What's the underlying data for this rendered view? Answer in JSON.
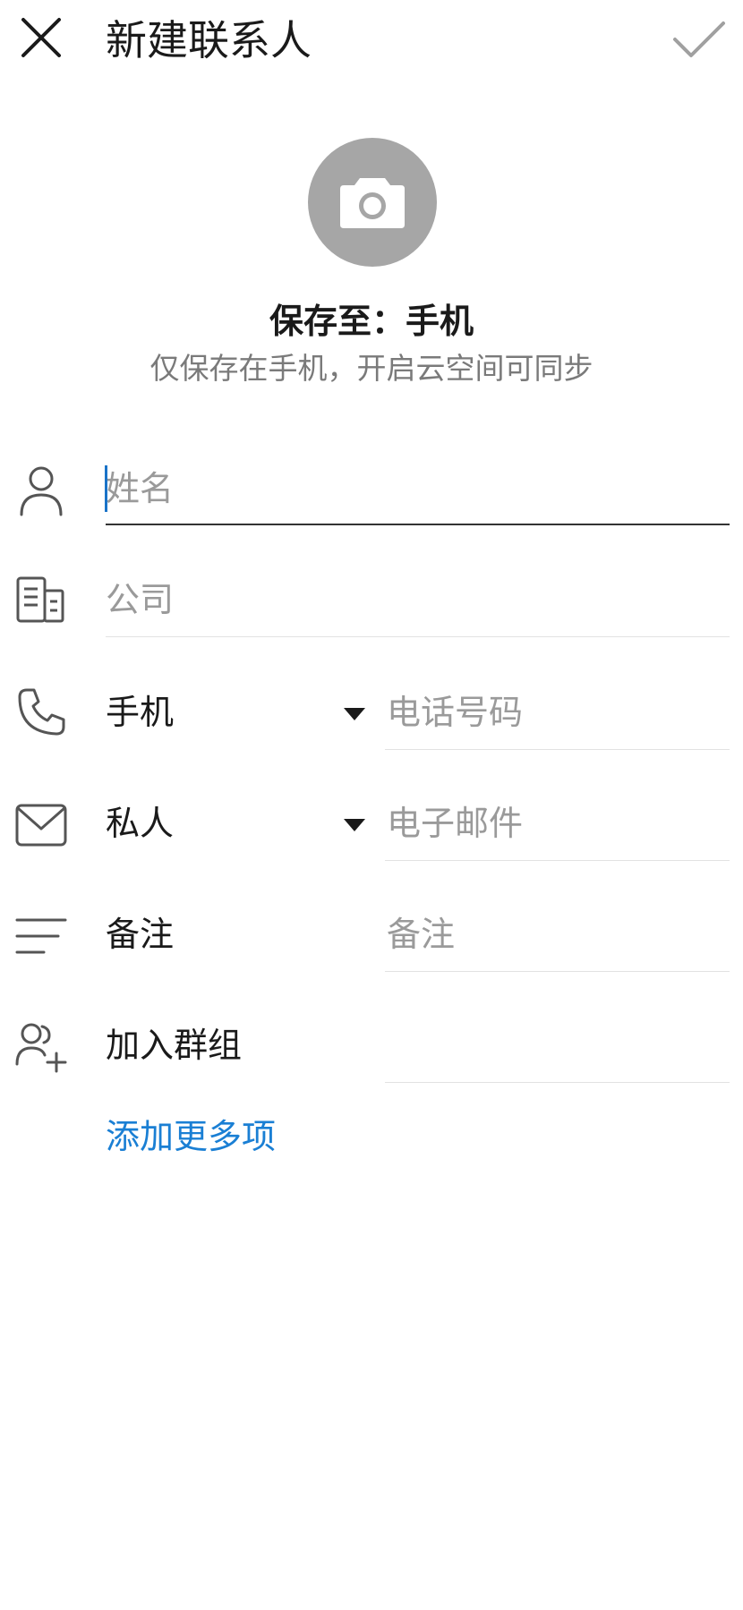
{
  "header": {
    "title": "新建联系人",
    "close_icon": "close-icon",
    "confirm_icon": "check-icon"
  },
  "avatar": {
    "icon": "camera-icon",
    "save_to": "保存至：手机",
    "save_hint": "仅保存在手机，开启云空间可同步"
  },
  "fields": {
    "name": {
      "icon": "person-icon",
      "placeholder": "姓名",
      "value": ""
    },
    "company": {
      "icon": "company-icon",
      "placeholder": "公司",
      "value": ""
    },
    "phone": {
      "icon": "phone-icon",
      "type_label": "手机",
      "placeholder": "电话号码",
      "value": ""
    },
    "email": {
      "icon": "mail-icon",
      "type_label": "私人",
      "placeholder": "电子邮件",
      "value": ""
    },
    "note": {
      "icon": "notes-icon",
      "label": "备注",
      "placeholder": "备注",
      "value": ""
    },
    "group": {
      "icon": "add-group-icon",
      "label": "加入群组"
    }
  },
  "add_more": "添加更多项",
  "colors": {
    "accent": "#1a7fd4",
    "cursor": "#1a73c8",
    "avatar_bg": "#a6a6a6",
    "placeholder": "#9a9a9a",
    "divider": "#e2e2e2"
  }
}
